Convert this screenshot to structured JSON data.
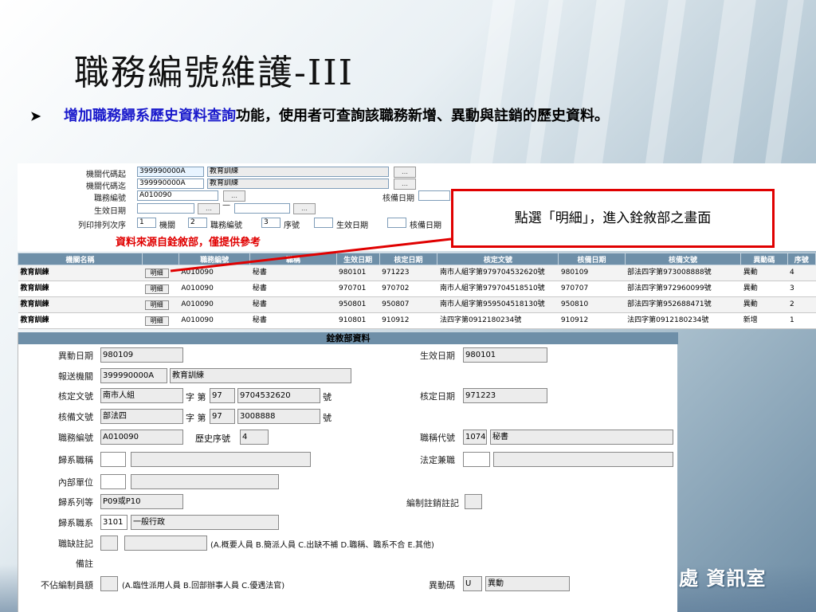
{
  "slide": {
    "title": "職務編號維護-III",
    "bullet_highlight": "增加職務歸系歷史資料查詢",
    "bullet_rest": "功能，使用者可查詢該職務新增、異動與註銷的歷史資料。"
  },
  "query": {
    "org_from_label": "機關代碼起",
    "org_from_code": "399990000A",
    "org_from_name": "教育訓練",
    "org_to_label": "機關代碼迄",
    "org_to_code": "399990000A",
    "org_to_name": "教育訓練",
    "job_no_label": "職務編號",
    "job_no": "A010090",
    "effective_date_label": "生效日期",
    "approve_date_label": "核備日期",
    "sort_label": "列印排列次序",
    "sort_1_value": "1",
    "sort_1_label": "機關",
    "sort_2_value": "2",
    "sort_2_label": "職務編號",
    "sort_3_value": "3",
    "sort_3_label": "序號",
    "sort_4_label": "生效日期",
    "sort_5_label": "核備日期",
    "dash": "—",
    "dots": "…",
    "red_note": "資料來源自銓敘部，僅提供參考"
  },
  "callout": {
    "text": "點選「明細」，進入銓敘部之畫面"
  },
  "table": {
    "headers": [
      "機關名稱",
      "",
      "職務編號",
      "職稱",
      "生效日期",
      "核定日期",
      "核定文號",
      "核備日期",
      "核備文號",
      "異動碼",
      "序號"
    ],
    "detail_label": "明細",
    "rows": [
      {
        "org": "教育訓練",
        "job_no": "A010090",
        "title": "秘書",
        "eff": "980101",
        "appr": "971223",
        "appr_doc": "南市人組字第9797045326​20號",
        "file_date": "980109",
        "file_doc": "部法四字第973008888號",
        "change": "異動",
        "seq": "4"
      },
      {
        "org": "教育訓練",
        "job_no": "A010090",
        "title": "秘書",
        "eff": "970701",
        "appr": "970702",
        "appr_doc": "南市人組字第979704518510號",
        "file_date": "970707",
        "file_doc": "部法四字第972960099號",
        "change": "異動",
        "seq": "3"
      },
      {
        "org": "教育訓練",
        "job_no": "A010090",
        "title": "秘書",
        "eff": "950801",
        "appr": "950807",
        "appr_doc": "南市人組字第959504518130號",
        "file_date": "950810",
        "file_doc": "部法四字第952688471號",
        "change": "異動",
        "seq": "2"
      },
      {
        "org": "教育訓練",
        "job_no": "A010090",
        "title": "秘書",
        "eff": "910801",
        "appr": "910912",
        "appr_doc": "法四字第0912180234號",
        "file_date": "910912",
        "file_doc": "法四字第0912180234號",
        "change": "新增",
        "seq": "1"
      }
    ]
  },
  "detail": {
    "title": "銓敘部資料",
    "change_date_label": "異動日期",
    "change_date": "980109",
    "eff_date_label": "生效日期",
    "eff_date": "980101",
    "send_org_label": "報送機關",
    "send_org_code": "399990000A",
    "send_org_name": "教育訓練",
    "appr_doc_label": "核定文號",
    "appr_doc_1": "南市人組",
    "zi_di": "字 第",
    "appr_doc_2": "97",
    "appr_doc_3": "9704532620",
    "hao": "號",
    "appr_date_label": "核定日期",
    "appr_date": "971223",
    "file_doc_label": "核備文號",
    "file_doc_1": "部法四",
    "file_doc_2": "97",
    "file_doc_3": "3008888",
    "job_no_label": "職務編號",
    "job_no": "A010090",
    "hist_seq_label": "歷史序號",
    "hist_seq": "4",
    "title_code_label": "職稱代號",
    "title_code": "1074",
    "title_name": "秘書",
    "series_title_label": "歸系職稱",
    "legal_concurrent_label": "法定兼職",
    "inner_unit_label": "內部單位",
    "series_grade_label": "歸系列等",
    "series_grade": "P09或P10",
    "quota_cancel_label": "編制註銷註記",
    "series_group_label": "歸系職系",
    "series_group_code": "3101",
    "series_group_name": "一般行政",
    "vacancy_label": "職缺註記",
    "vacancy_note": "(A.概要人員 B.簡派人員 C.出缺不補 D.職稱、職系不合 E.其他)",
    "remark_label": "備註",
    "non_quota_label": "不佔編制員額",
    "non_quota_note": "(A.臨性派用人員 B.回部辦事人員 C.優遇法官)",
    "change_code_label": "異動碼",
    "change_code": "U",
    "change_name": "異動"
  },
  "brand": {
    "text": "處 資訊室"
  }
}
